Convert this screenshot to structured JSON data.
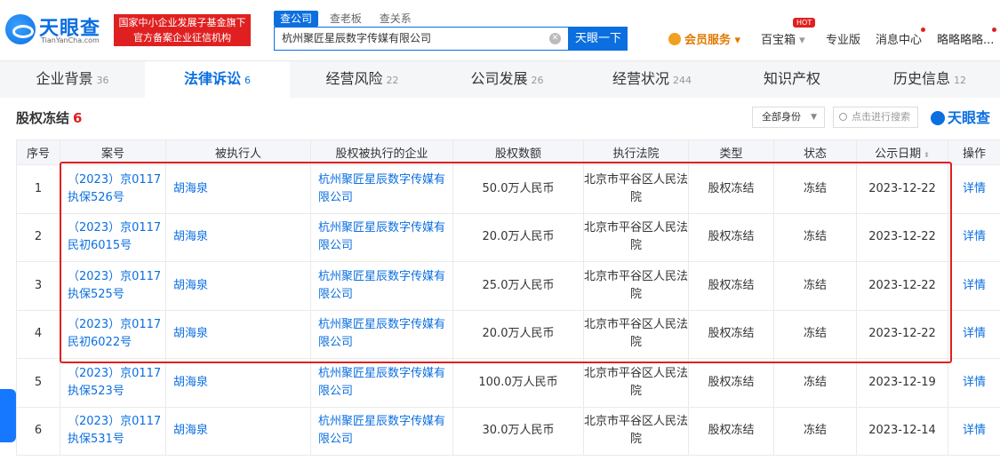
{
  "header": {
    "logo_name": "天眼查",
    "logo_sub": "TianYanCha.com",
    "banner_line1": "国家中小企业发展子基金旗下",
    "banner_line2": "官方备案企业征信机构",
    "search_tabs": [
      "查公司",
      "查老板",
      "查关系"
    ],
    "search_value": "杭州聚匠星辰数字传媒有限公司",
    "search_button": "天眼一下",
    "vip": "会员服务",
    "baibao": "百宝箱",
    "hot": "HOT",
    "pro": "专业版",
    "msg": "消息中心",
    "user": "略略略略..."
  },
  "tabs": [
    {
      "label": "企业背景",
      "count": "36"
    },
    {
      "label": "法律诉讼",
      "count": "6"
    },
    {
      "label": "经营风险",
      "count": "22"
    },
    {
      "label": "公司发展",
      "count": "26"
    },
    {
      "label": "经营状况",
      "count": "244"
    },
    {
      "label": "知识产权",
      "count": ""
    },
    {
      "label": "历史信息",
      "count": "12"
    }
  ],
  "section": {
    "title": "股权冻结",
    "count": "6",
    "identity_select": "全部身份",
    "search_placeholder": "点击进行搜索",
    "watermark": "天眼查"
  },
  "table": {
    "headers": [
      "序号",
      "案号",
      "被执行人",
      "股权被执行的企业",
      "股权数额",
      "执行法院",
      "类型",
      "状态",
      "公示日期",
      "操作"
    ],
    "rows": [
      {
        "no": "1",
        "case": "（2023）京0117执保526号",
        "person": "胡海泉",
        "company": "杭州聚匠星辰数字传媒有限公司",
        "amount": "50.0万人民币",
        "court": "北京市平谷区人民法院",
        "type": "股权冻结",
        "status": "冻结",
        "date": "2023-12-22",
        "op": "详情"
      },
      {
        "no": "2",
        "case": "（2023）京0117民初6015号",
        "person": "胡海泉",
        "company": "杭州聚匠星辰数字传媒有限公司",
        "amount": "20.0万人民币",
        "court": "北京市平谷区人民法院",
        "type": "股权冻结",
        "status": "冻结",
        "date": "2023-12-22",
        "op": "详情"
      },
      {
        "no": "3",
        "case": "（2023）京0117执保525号",
        "person": "胡海泉",
        "company": "杭州聚匠星辰数字传媒有限公司",
        "amount": "25.0万人民币",
        "court": "北京市平谷区人民法院",
        "type": "股权冻结",
        "status": "冻结",
        "date": "2023-12-22",
        "op": "详情"
      },
      {
        "no": "4",
        "case": "（2023）京0117民初6022号",
        "person": "胡海泉",
        "company": "杭州聚匠星辰数字传媒有限公司",
        "amount": "20.0万人民币",
        "court": "北京市平谷区人民法院",
        "type": "股权冻结",
        "status": "冻结",
        "date": "2023-12-22",
        "op": "详情"
      },
      {
        "no": "5",
        "case": "（2023）京0117执保523号",
        "person": "胡海泉",
        "company": "杭州聚匠星辰数字传媒有限公司",
        "amount": "100.0万人民币",
        "court": "北京市平谷区人民法院",
        "type": "股权冻结",
        "status": "冻结",
        "date": "2023-12-19",
        "op": "详情"
      },
      {
        "no": "6",
        "case": "（2023）京0117执保531号",
        "person": "胡海泉",
        "company": "杭州聚匠星辰数字传媒有限公司",
        "amount": "30.0万人民币",
        "court": "北京市平谷区人民法院",
        "type": "股权冻结",
        "status": "冻结",
        "date": "2023-12-14",
        "op": "详情"
      }
    ]
  },
  "colors": {
    "brand": "#0b6fe0",
    "alert": "#e02020",
    "vip": "#e07a00"
  }
}
